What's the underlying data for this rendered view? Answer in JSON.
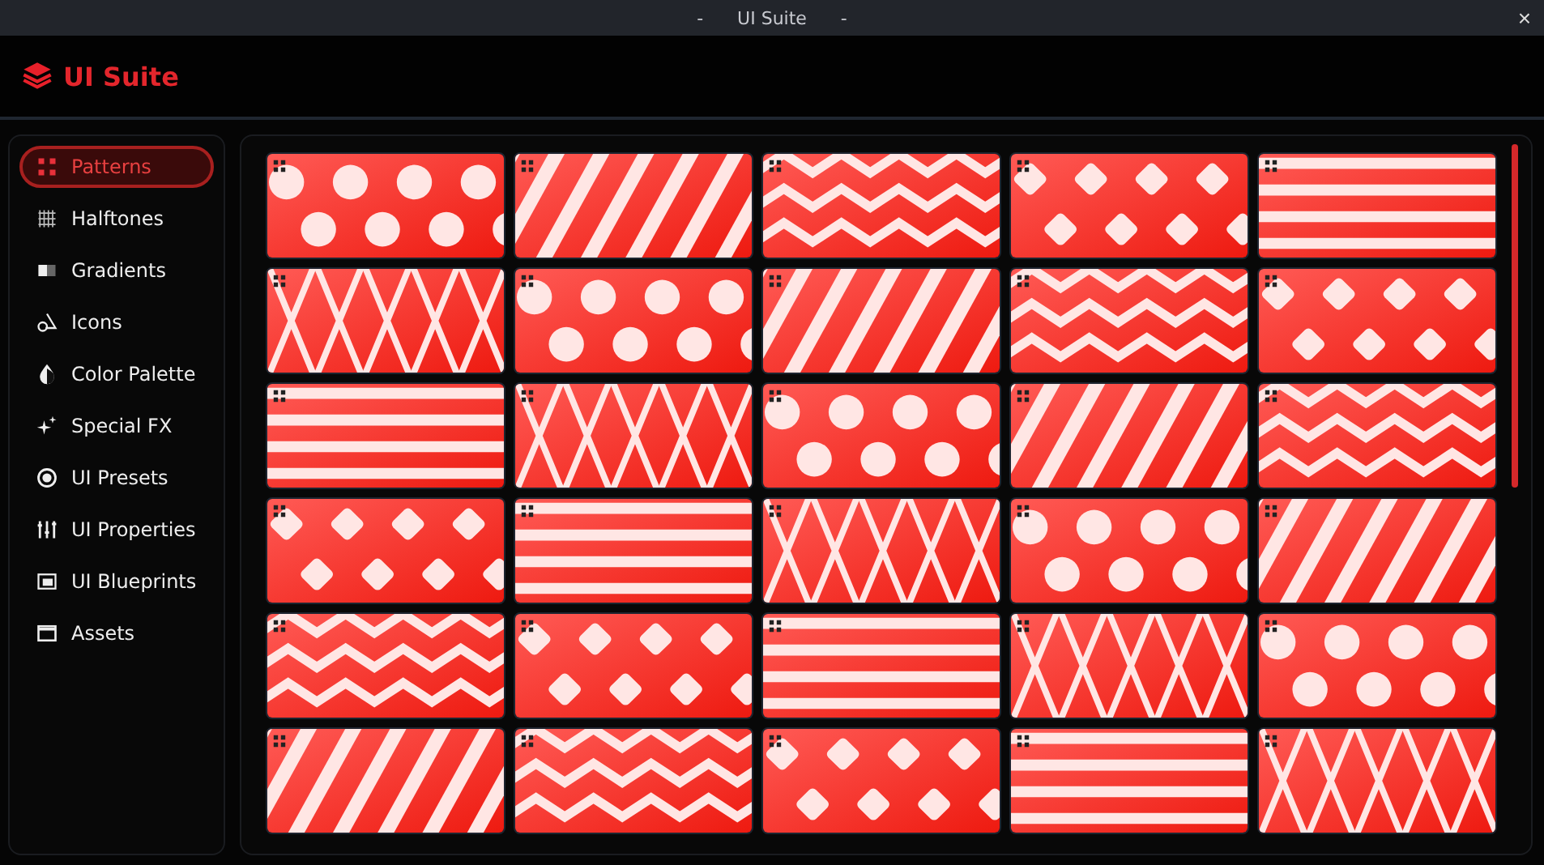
{
  "window": {
    "title": "-      UI Suite      -",
    "close": "×"
  },
  "app": {
    "name": "UI Suite"
  },
  "sidebar": {
    "items": [
      {
        "label": "Patterns",
        "selected": true
      },
      {
        "label": "Halftones",
        "selected": false
      },
      {
        "label": "Gradients",
        "selected": false
      },
      {
        "label": "Icons",
        "selected": false
      },
      {
        "label": "Color Palette",
        "selected": false
      },
      {
        "label": "Special FX",
        "selected": false
      },
      {
        "label": "UI Presets",
        "selected": false
      },
      {
        "label": "UI Properties",
        "selected": false
      },
      {
        "label": "UI Blueprints",
        "selected": false
      },
      {
        "label": "Assets",
        "selected": false
      }
    ]
  }
}
